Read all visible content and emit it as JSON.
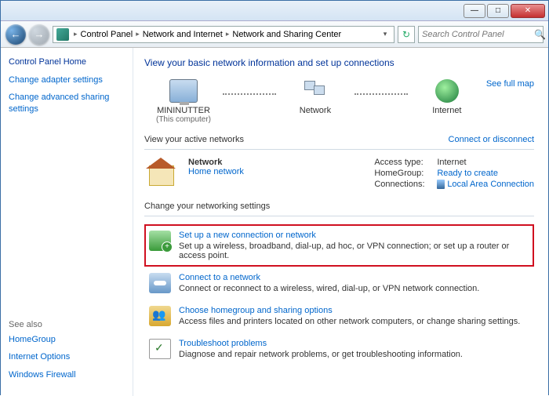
{
  "titlebar": {},
  "nav": {
    "breadcrumbs": [
      "Control Panel",
      "Network and Internet",
      "Network and Sharing Center"
    ],
    "search_placeholder": "Search Control Panel"
  },
  "sidebar": {
    "home": "Control Panel Home",
    "links": [
      "Change adapter settings",
      "Change advanced sharing settings"
    ],
    "seealso_heading": "See also",
    "seealso": [
      "HomeGroup",
      "Internet Options",
      "Windows Firewall"
    ]
  },
  "main": {
    "heading": "View your basic network information and set up connections",
    "map": {
      "full_map_link": "See full map",
      "nodes": [
        {
          "label": "MININUTTER",
          "sub": "(This computer)"
        },
        {
          "label": "Network",
          "sub": ""
        },
        {
          "label": "Internet",
          "sub": ""
        }
      ]
    },
    "active_heading": "View your active networks",
    "active_link": "Connect or disconnect",
    "network": {
      "name": "Network",
      "type_link": "Home network",
      "props": [
        {
          "k": "Access type:",
          "v": "Internet",
          "link": false
        },
        {
          "k": "HomeGroup:",
          "v": "Ready to create",
          "link": true
        },
        {
          "k": "Connections:",
          "v": "Local Area Connection",
          "link": true,
          "icon": true
        }
      ]
    },
    "change_heading": "Change your networking settings",
    "options": [
      {
        "title": "Set up a new connection or network",
        "desc": "Set up a wireless, broadband, dial-up, ad hoc, or VPN connection; or set up a router or access point.",
        "highlight": true,
        "icon": "new"
      },
      {
        "title": "Connect to a network",
        "desc": "Connect or reconnect to a wireless, wired, dial-up, or VPN network connection.",
        "highlight": false,
        "icon": "conn"
      },
      {
        "title": "Choose homegroup and sharing options",
        "desc": "Access files and printers located on other network computers, or change sharing settings.",
        "highlight": false,
        "icon": "hg"
      },
      {
        "title": "Troubleshoot problems",
        "desc": "Diagnose and repair network problems, or get troubleshooting information.",
        "highlight": false,
        "icon": "ts"
      }
    ]
  }
}
